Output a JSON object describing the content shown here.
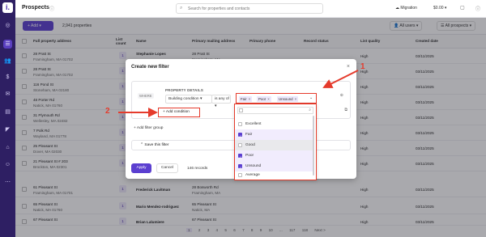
{
  "app": {
    "logo_glyph": "i."
  },
  "sidebar": {
    "icons": [
      "compass-icon",
      "list-icon",
      "users-icon",
      "dollar-icon",
      "inbox-icon",
      "book-icon",
      "megaphone-icon",
      "org-icon",
      "team-icon",
      "more-icon"
    ]
  },
  "header": {
    "title": "Prospects",
    "search_placeholder": "Search for properties and contacts",
    "migration": "Migration",
    "balance": "$0.00"
  },
  "toolbar": {
    "add_label": "Add",
    "count_label": "2,941 properties",
    "all_users": "All users",
    "all_prospects": "All prospects"
  },
  "table": {
    "columns": [
      "Full property address",
      "List count",
      "Name",
      "Primary mailing address",
      "Primary phone",
      "Record status",
      "List quality",
      "Created date"
    ],
    "rows": [
      {
        "addr": "28 Pratt St",
        "city": "Framingham, MA 01702",
        "count": "1",
        "name": "Stephanie Lopes",
        "mail": "28 Pratt St",
        "mail_city": "Framingham, MA",
        "quality": "High",
        "date": "03/11/2025"
      },
      {
        "addr": "28 Pratt St",
        "city": "Framingham, MA 01702",
        "count": "1",
        "name": "",
        "mail": "",
        "mail_city": "",
        "quality": "High",
        "date": "03/11/2025"
      },
      {
        "addr": "116 Pond St",
        "city": "Stoneham, MA 02180",
        "count": "1",
        "name": "",
        "mail": "",
        "mail_city": "",
        "quality": "High",
        "date": "03/11/2025"
      },
      {
        "addr": "48 Porter Rd",
        "city": "Natick, MA 01760",
        "count": "1",
        "name": "",
        "mail": "",
        "mail_city": "",
        "quality": "High",
        "date": "03/11/2025"
      },
      {
        "addr": "31 Plymouth Rd",
        "city": "Wellesley, MA 02482",
        "count": "1",
        "name": "",
        "mail": "",
        "mail_city": "",
        "quality": "High",
        "date": "03/11/2025"
      },
      {
        "addr": "7 Polk Rd",
        "city": "Wayland, MA 01778",
        "count": "1",
        "name": "",
        "mail": "",
        "mail_city": "",
        "quality": "High",
        "date": "03/11/2025"
      },
      {
        "addr": "25 Pleasant St",
        "city": "Dover, MA 02030",
        "count": "1",
        "name": "",
        "mail": "",
        "mail_city": "",
        "quality": "High",
        "date": "03/11/2025"
      },
      {
        "addr": "21 Pleasant St # 203",
        "city": "Brockton, MA 02301",
        "count": "1",
        "name": "",
        "mail": "",
        "mail_city": "",
        "quality": "High",
        "date": "03/11/2025"
      },
      {
        "addr": "61 Pleasant St",
        "city": "Framingham, MA 01701",
        "count": "1",
        "name": "Frederick Lavitman",
        "mail": "28 Bosworth Rd",
        "mail_city": "Framingham, MA",
        "quality": "High",
        "date": "03/11/2025"
      },
      {
        "addr": "65 Pleasant St",
        "city": "Natick, MA 01760",
        "count": "1",
        "name": "Mario Mendez-rodriguez",
        "mail": "65 Pleasant St",
        "mail_city": "Natick, MA",
        "quality": "High",
        "date": "03/11/2025"
      },
      {
        "addr": "67 Pleasant St",
        "city": "",
        "count": "1",
        "name": "Brian Lalumiere",
        "mail": "67 Pleasant St",
        "mail_city": "",
        "quality": "High",
        "date": "03/11/2025"
      }
    ]
  },
  "modal": {
    "title": "Create new filter",
    "where_label": "WHERE",
    "section_label": "PROPERTY DETAILS",
    "field": "Building condition",
    "operator": "is any of",
    "add_condition": "+ Add condition",
    "add_filter_group": "+ Add filter group",
    "save_filter": "Save this filter",
    "apply": "Apply",
    "cancel": "Cancel",
    "records": "146 records",
    "selected_tags": [
      "Fair",
      "Poor",
      "Unsound"
    ],
    "options": [
      {
        "label": "Excellent",
        "checked": false
      },
      {
        "label": "Fair",
        "checked": true
      },
      {
        "label": "Good",
        "checked": false
      },
      {
        "label": "Poor",
        "checked": true
      },
      {
        "label": "Unsound",
        "checked": true
      },
      {
        "label": "Average",
        "checked": false
      }
    ]
  },
  "annotations": {
    "num1": "1",
    "num2": "2"
  },
  "pager": {
    "pages": [
      "1",
      "2",
      "3",
      "4",
      "5",
      "6",
      "7",
      "8",
      "9",
      "10",
      "...",
      "117",
      "118",
      "Next >"
    ]
  },
  "colors": {
    "brand": "#5b3fd0",
    "sidebar": "#2e1f63",
    "annotation": "#e53b2c"
  }
}
